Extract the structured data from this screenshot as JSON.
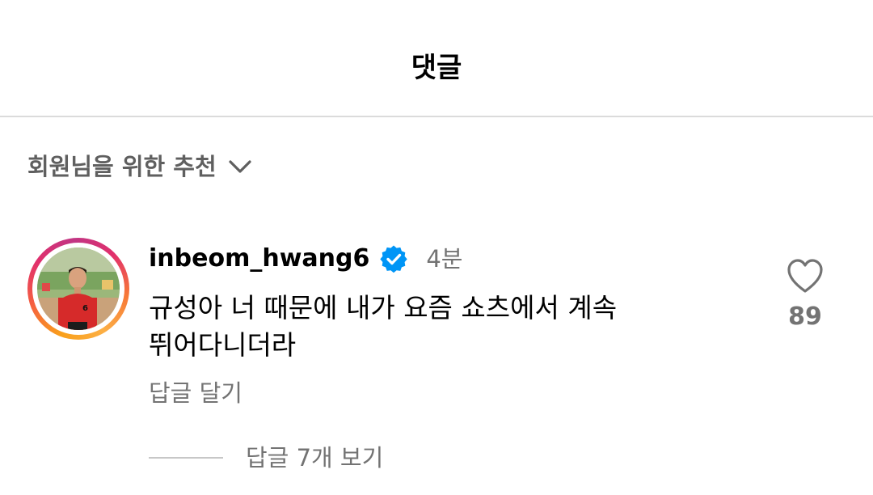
{
  "header": {
    "title": "댓글"
  },
  "sort": {
    "label": "회원님을 위한 추천",
    "icon": "chevron-down-icon"
  },
  "comment": {
    "username": "inbeom_hwang6",
    "verified": true,
    "time": "4분",
    "text_lines": [
      "규성아 너 때문에 내가 요즘 쇼츠에서 계속",
      "뛰어다니더라"
    ],
    "reply_label": "답글 달기",
    "like_count": "89",
    "view_replies_label": "답글 7개 보기"
  },
  "colors": {
    "verified_blue": "#0095f6",
    "secondary_text": "#737373",
    "divider": "#dbdbdb",
    "jersey_red": "#d62a2a"
  }
}
